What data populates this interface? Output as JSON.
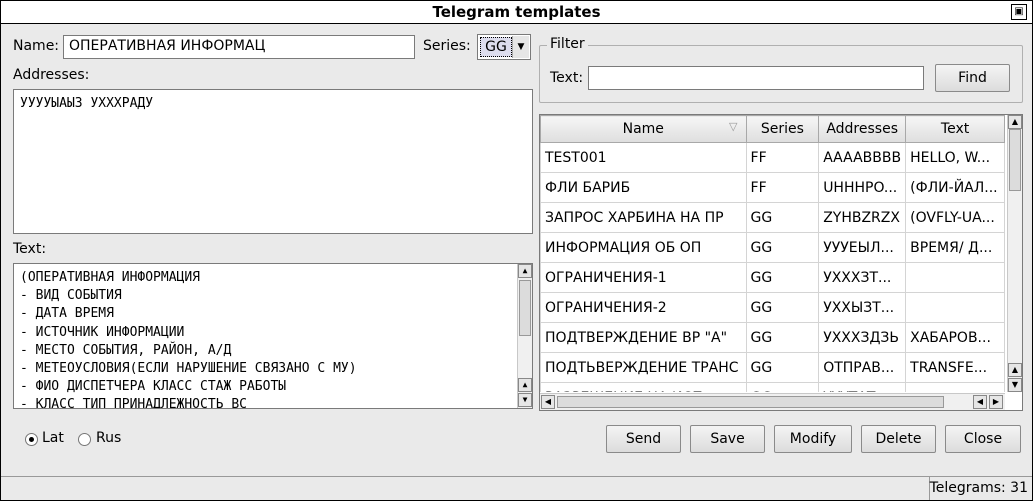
{
  "window": {
    "title": "Telegram templates",
    "restore_icon": "restore-icon"
  },
  "form": {
    "name_label": "Name:",
    "name_value": "ОПЕРАТИВНАЯ ИНФОРМАЦ",
    "series_label": "Series:",
    "series_value": "GG",
    "addresses_label": "Addresses:",
    "addresses_value": "УУУУЫАЫЗ УХХХРАДУ",
    "text_label": "Text:",
    "text_lines": [
      "(ОПЕРАТИВНАЯ ИНФОРМАЦИЯ",
      "- ВИД СОБЫТИЯ",
      "- ДАТА ВРЕМЯ",
      "- ИСТОЧНИК ИНФОРМАЦИИ",
      "- МЕСТО СОБЫТИЯ, РАЙОН, А/Д",
      "- МЕТЕОУСЛОВИЯ(ЕСЛИ НАРУШЕНИЕ СВЯЗАНО С МУ)",
      "- ФИО ДИСПЕТЧЕРА КЛАСС СТАЖ РАБОТЫ",
      "- КЛАСС ТИП ПРИНАДЛЕЖНОСТЬ ВС"
    ]
  },
  "filter": {
    "legend": "Filter",
    "text_label": "Text:",
    "text_value": "",
    "find_label": "Find"
  },
  "table": {
    "columns": [
      "Name",
      "Series",
      "Addresses",
      "Text"
    ],
    "rows": [
      [
        "TEST001",
        "FF",
        "AAAABBBB",
        "HELLO, W..."
      ],
      [
        "ФЛИ БАРИБ",
        "FF",
        "UHHHPO...",
        "(ФЛИ-ЙАЛ..."
      ],
      [
        "ЗАПРОС ХАРБИНА НА ПР",
        "GG",
        "ZYHBZRZX",
        "(OVFLY-UA..."
      ],
      [
        "ИНФОРМАЦИЯ ОБ ОП",
        "GG",
        "УУУЕЫЛ...",
        "ВРЕМЯ/ Д..."
      ],
      [
        "ОГРАНИЧЕНИЯ-1",
        "GG",
        "УХХХЗТ...",
        ""
      ],
      [
        "ОГРАНИЧЕНИЯ-2",
        "GG",
        "УХХЫЗТ...",
        ""
      ],
      [
        "ПОДТВЕРЖДЕНИЕ ВР \"А\"",
        "GG",
        "УХХХЗДЗЬ",
        "ХАБАРОВ..."
      ],
      [
        "ПОДТЬВЕРЖДЕНИЕ ТРАНС",
        "GG",
        "ОТПРАВ...",
        "TRANSFE..."
      ],
      [
        "РАЗРЕШЕНИЕ НА ИСП",
        "GG",
        "УУУТАТ...",
        ""
      ]
    ]
  },
  "language": {
    "options": [
      "Lat",
      "Rus"
    ],
    "selected": "Lat"
  },
  "buttons": {
    "send": "Send",
    "save": "Save",
    "modify": "Modify",
    "delete": "Delete",
    "close": "Close"
  },
  "status": {
    "telegrams": "Telegrams: 31"
  }
}
